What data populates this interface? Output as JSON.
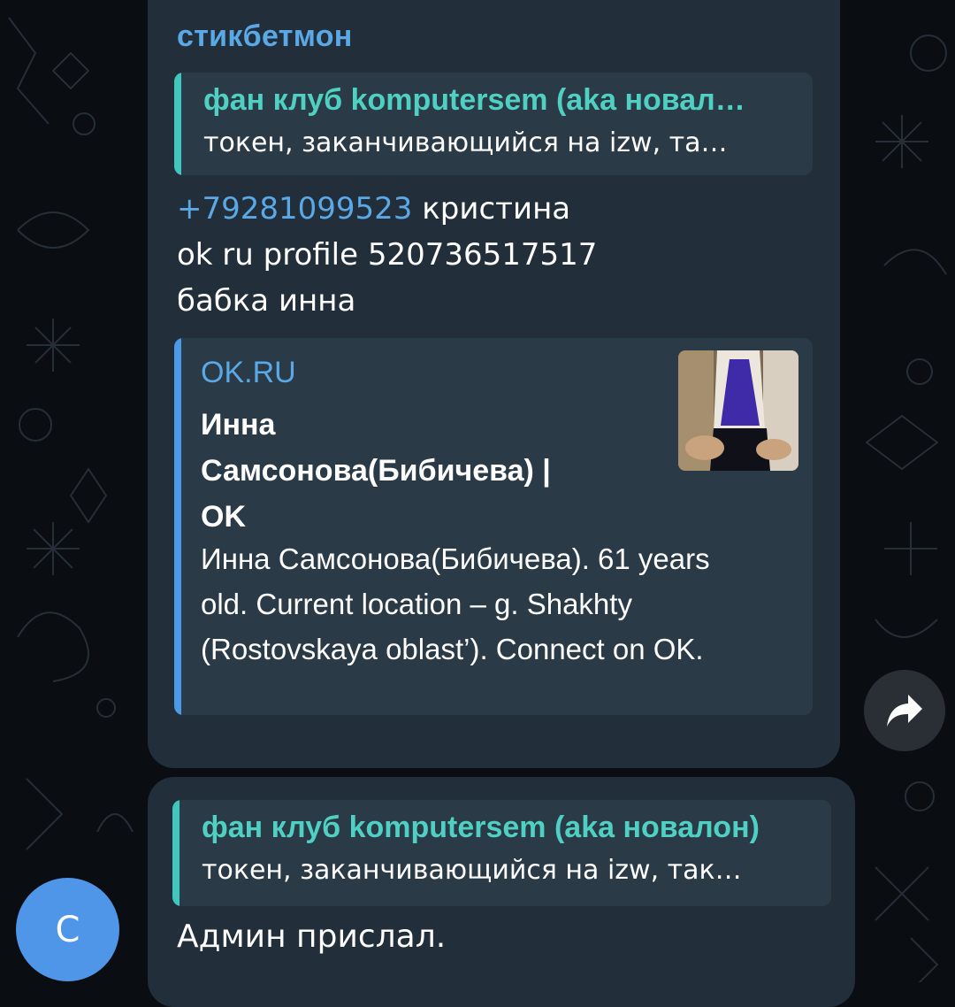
{
  "message1": {
    "sender": "стикбетмон",
    "reply": {
      "title": "фан клуб komputersem (aka новал…",
      "text": "токен, заканчивающийся на izw, та…"
    },
    "phone": "+79281099523",
    "phone_suffix": " кристина",
    "line2": "ok ru profile 520736517517",
    "line3": "бабка инна",
    "link_preview": {
      "site": "OK.RU",
      "title": "Инна Самсонова(Бибичева) | OK",
      "description": "Инна Самсонова(Бибичева). 61 years old. Current location – g. Shakhty (Rostovskaya oblast’). Connect on OK.",
      "thumbnail_icon": "profile-photo"
    }
  },
  "message2": {
    "reply": {
      "title": "фан клуб komputersem (aka новалон)",
      "text": "токен, заканчивающийся на izw, так…"
    },
    "text": "Админ прислал."
  },
  "avatar": {
    "letter": "С",
    "color": "#4f95e8"
  },
  "share_button": {
    "icon": "share-arrow-icon"
  },
  "colors": {
    "background": "#0a0d12",
    "bubble": "#222e3a",
    "quote": "#2a3a46",
    "accent_teal": "#3fc7bd",
    "link_blue": "#5aa9e6"
  }
}
